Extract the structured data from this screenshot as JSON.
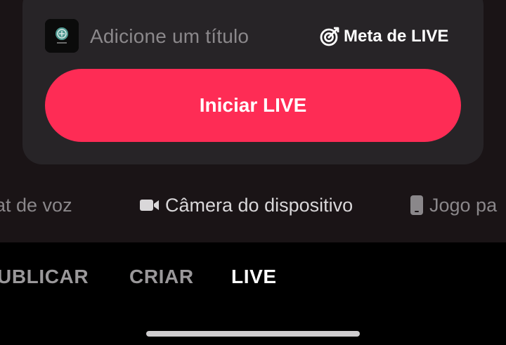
{
  "card": {
    "title_placeholder": "Adicione um título",
    "goal_label": "Meta de LIVE",
    "start_label": "Iniciar LIVE"
  },
  "modes": [
    {
      "label": "at de voz",
      "icon": "voice-chat-icon"
    },
    {
      "label": "Câmera do dispositivo",
      "icon": "video-camera-icon"
    },
    {
      "label": "Jogo pa",
      "icon": "phone-icon"
    }
  ],
  "tabs": [
    {
      "label": "UBLICAR",
      "active": false
    },
    {
      "label": "CRIAR",
      "active": false
    },
    {
      "label": "LIVE",
      "active": true
    }
  ],
  "colors": {
    "accent": "#fe2c55",
    "card_bg": "#272427",
    "background": "#1a1416"
  }
}
